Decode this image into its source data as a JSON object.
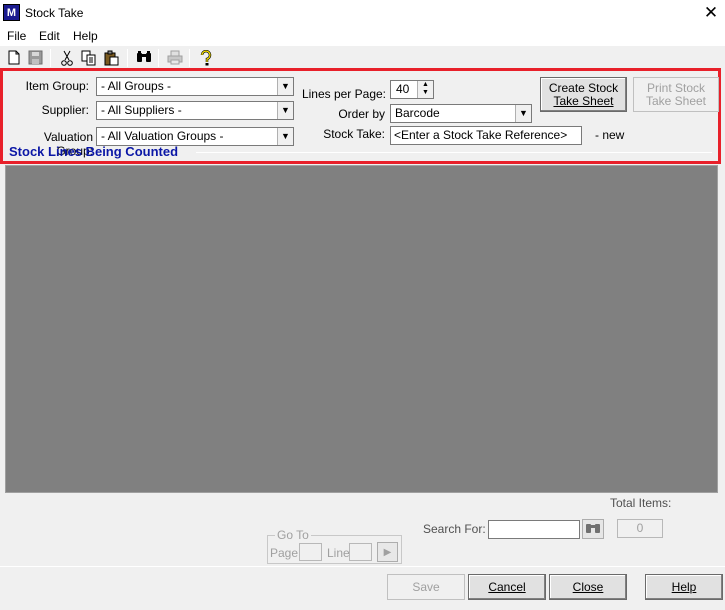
{
  "window": {
    "title": "Stock Take",
    "close_glyph": "✕",
    "app_icon_text": "M"
  },
  "menu": {
    "file": "File",
    "edit": "Edit",
    "help": "Help"
  },
  "toolbar": {
    "icons": [
      "new-icon",
      "save-icon",
      "cut-icon",
      "copy-icon",
      "paste-icon",
      "find-icon",
      "print-icon",
      "help-icon"
    ]
  },
  "filters": {
    "item_group_label": "Item Group:",
    "item_group_value": "- All Groups -",
    "supplier_label": "Supplier:",
    "supplier_value": "- All Suppliers -",
    "valuation_group_label": "Valuation Group:",
    "valuation_group_value": "- All Valuation Groups -",
    "lines_per_page_label": "Lines per Page:",
    "lines_per_page_value": "40",
    "order_by_label": "Order by",
    "order_by_value": "Barcode",
    "stock_take_label": "Stock Take:",
    "stock_take_value": "<Enter a Stock Take Reference>",
    "stock_take_status": "- new",
    "create_sheet_line1": "Create Stock",
    "create_sheet_line2": "Take Sheet",
    "print_sheet_line1": "Print Stock",
    "print_sheet_line2": "Take Sheet"
  },
  "section": {
    "title": "Stock Lines Being Counted"
  },
  "footer": {
    "total_items_label": "Total Items:",
    "total_items_value": "0",
    "search_for_label": "Search For:",
    "search_value": "",
    "goto_label": "Go To",
    "page_label": "Page",
    "line_label": "Line",
    "save_label": "Save",
    "cancel_label": "Cancel",
    "close_label": "Close",
    "help_label": "Help"
  }
}
